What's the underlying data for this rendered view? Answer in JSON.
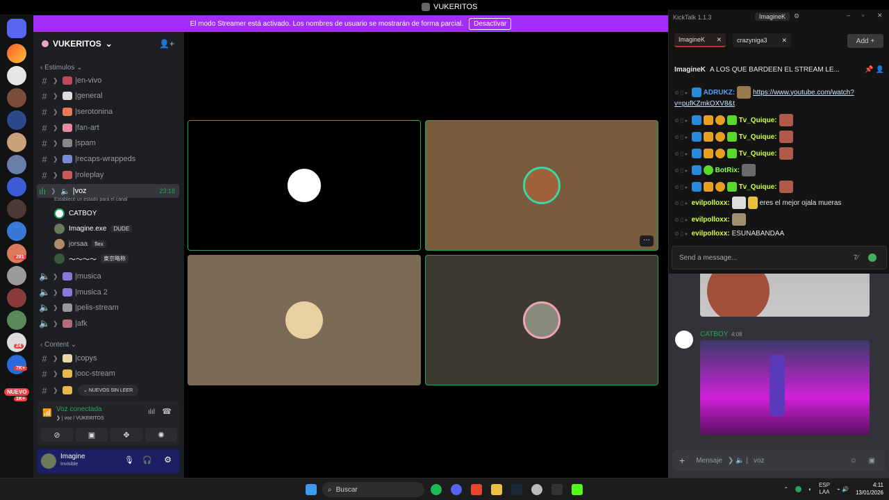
{
  "titlebar": {
    "title": "VUKERITOS"
  },
  "banner": {
    "text": "El modo Streamer está activado. Los nombres de usuario se mostrarán de forma parcial.",
    "button": "Desactivar"
  },
  "rail": {
    "badges": [
      "281",
      "7K+",
      "24",
      "NUEVO",
      "1K+"
    ]
  },
  "server": {
    "name": "VUKERITOS"
  },
  "categories": {
    "estimulos": "Estimulos",
    "content": "Content"
  },
  "channels": [
    {
      "name": "en-vivo"
    },
    {
      "name": "general"
    },
    {
      "name": "serotonina"
    },
    {
      "name": "fan-art"
    },
    {
      "name": "spam"
    },
    {
      "name": "recaps-wrappeds"
    },
    {
      "name": "roleplay"
    }
  ],
  "voice_channel": {
    "name": "voz",
    "time": "23:18",
    "status_hint": "Establece un estado para el canal"
  },
  "members": [
    {
      "name": "CATBOY",
      "tag": ""
    },
    {
      "name": "Imagine.exe",
      "tag": "DUDE"
    },
    {
      "name": "jorsaa",
      "tag": "flex"
    },
    {
      "name": "～～～～",
      "tag": "東京略称"
    }
  ],
  "voice_channels_more": [
    {
      "name": "musica"
    },
    {
      "name": "musica 2"
    },
    {
      "name": "pelis-stream"
    },
    {
      "name": "afk"
    }
  ],
  "content_channels": [
    {
      "name": "copys"
    },
    {
      "name": "ooc-stream"
    }
  ],
  "new_unread": "NUEVOS SIN LEER",
  "voice_panel": {
    "status": "Voz conectada",
    "location": "voz / VUKERITOS"
  },
  "user": {
    "name": "Imagine",
    "status": "Invisible"
  },
  "kicktalk": {
    "title": "KickTalk 1.1.3",
    "account": "ImagineK",
    "tabs": [
      "ImagineK",
      "crazyniga3"
    ],
    "add": "Add",
    "pinned_user": "ImagineK",
    "pinned_text": "A LOS QUE BARDEEN EL STREAM LE...",
    "messages": [
      {
        "user": "ADRUKZ:",
        "color": "#4ea1ff",
        "text": "https://www.youtube.com/watch?",
        "text2": "v=pufKZmkOXV8&t"
      },
      {
        "user": "Tv_Quique:",
        "color": "#d5ff3a",
        "text": ""
      },
      {
        "user": "Tv_Quique:",
        "color": "#d5ff3a",
        "text": ""
      },
      {
        "user": "Tv_Quique:",
        "color": "#d5ff3a",
        "text": ""
      },
      {
        "user": "BotRix:",
        "color": "#8bff4a",
        "text": ""
      },
      {
        "user": "Tv_Quique:",
        "color": "#d5ff3a",
        "text": ""
      },
      {
        "user": "evilpolloxx:",
        "color": "#d5ff3a",
        "text": "eres el mejor ojala mueras"
      },
      {
        "user": "evilpolloxx:",
        "color": "#d5ff3a",
        "text": ""
      },
      {
        "user": "evilpolloxx:",
        "color": "#d5ff3a",
        "text": "ESUNABANDAA"
      }
    ],
    "input_placeholder": "Send a message..."
  },
  "chat": {
    "author": "CATBOY",
    "time": "4:08",
    "input_placeholder": "Mensaje",
    "input_channel": "voz"
  },
  "taskbar": {
    "search": "Buscar",
    "lang": "ESP",
    "lang2": "LAA",
    "time": "4:11",
    "date": "13/01/2026"
  }
}
